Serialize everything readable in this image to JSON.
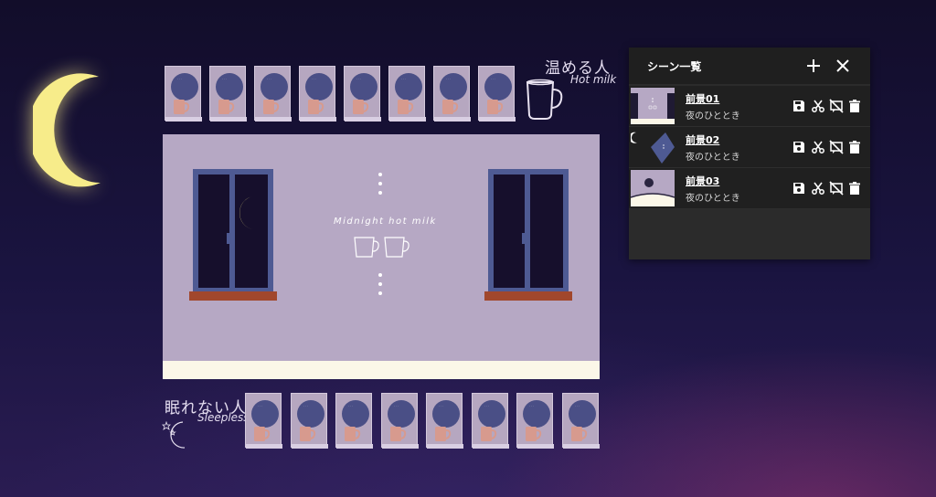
{
  "top_row": {
    "title_jp": "温める人",
    "title_en": "Hot milk",
    "card_count": 8
  },
  "bottom_row": {
    "title_jp": "眠れない人",
    "title_en": "Sleepless",
    "card_count": 8
  },
  "stage": {
    "title": "Midnight hot milk"
  },
  "scene_panel": {
    "title": "シーン一覧",
    "add_icon": "plus-icon",
    "close_icon": "close-icon",
    "scenes": [
      {
        "name": "前景01",
        "subtitle": "夜のひととき"
      },
      {
        "name": "前景02",
        "subtitle": "夜のひととき"
      },
      {
        "name": "前景03",
        "subtitle": "夜のひととき"
      }
    ],
    "row_actions": [
      "save-icon",
      "scissors-icon",
      "hide-comment-icon",
      "trash-icon"
    ]
  },
  "colors": {
    "background": "#1a1440",
    "stage": "#b6a8c4",
    "card": "#b6a7c0",
    "moon": "#f7ec8a",
    "window_frame": "#4e5a93",
    "sill": "#a1472c",
    "panel": "#2b2b2b"
  }
}
